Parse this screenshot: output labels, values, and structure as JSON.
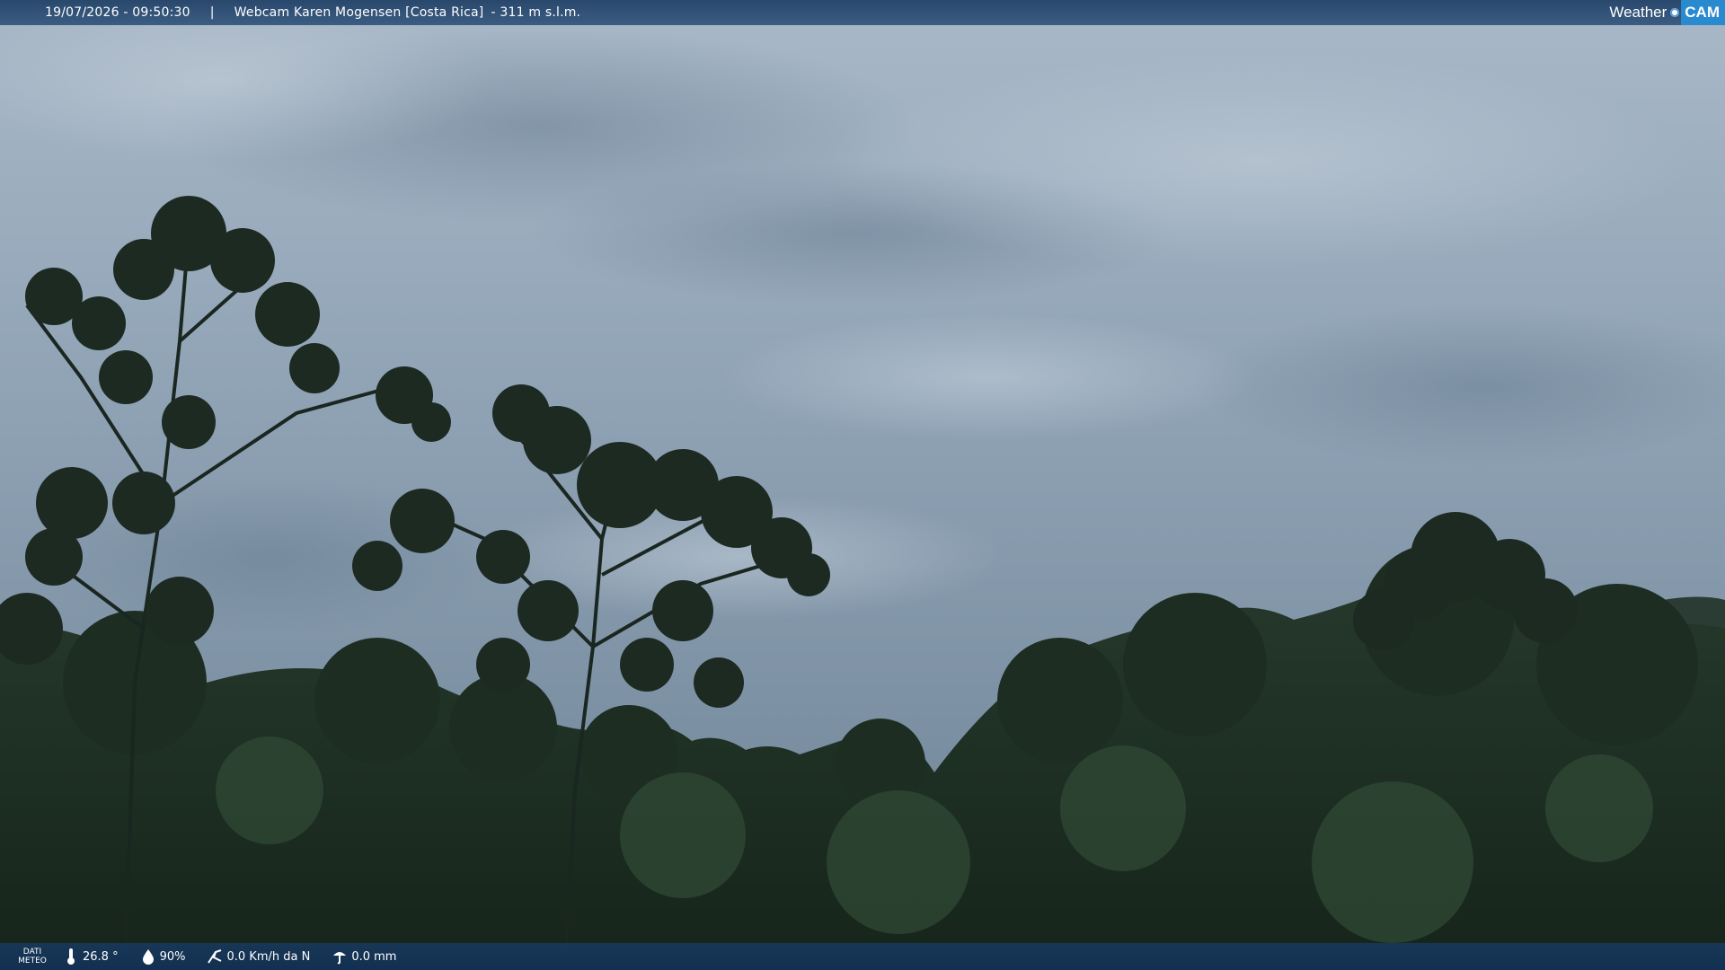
{
  "overlay_top": {
    "datetime": "19/07/2026 - 09:50:30",
    "separator": "|",
    "webcam_title": "Webcam Karen Mogensen [Costa Rica]",
    "altitude": "- 311 m s.l.m."
  },
  "logo": {
    "weather_text": "Weather",
    "cam_text": "CAM"
  },
  "overlay_bottom": {
    "label_line1": "DATI",
    "label_line2": "METEO",
    "temperature": "26.8 °",
    "humidity": "90%",
    "wind": "0.0 Km/h da N",
    "rain": "0.0 mm",
    "icons": [
      "thermometer-icon",
      "humidity-drop-icon",
      "wind-icon",
      "rain-gauge-icon"
    ]
  },
  "colors": {
    "bar_blue": "#1e3e64",
    "logo_blue": "#2a8ad0",
    "sky": "#8a9db0",
    "foliage": "#1f2e24"
  }
}
